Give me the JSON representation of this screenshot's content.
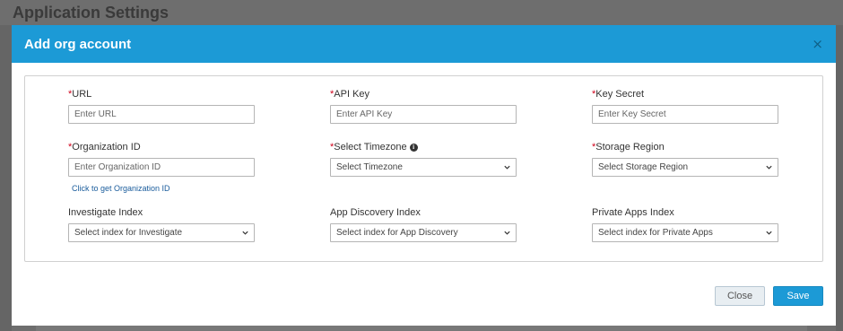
{
  "background": {
    "page_title": "Application Settings"
  },
  "modal": {
    "title": "Add org account",
    "close_glyph": "×",
    "required_marker": "*"
  },
  "fields": {
    "url": {
      "label": "URL",
      "placeholder": "Enter URL",
      "required": true
    },
    "api_key": {
      "label": "API Key",
      "placeholder": "Enter API Key",
      "required": true
    },
    "key_secret": {
      "label": "Key Secret",
      "placeholder": "Enter Key Secret",
      "required": true
    },
    "org_id": {
      "label": "Organization ID",
      "placeholder": "Enter Organization ID",
      "required": true,
      "help_link": "Click to get Organization ID"
    },
    "timezone": {
      "label": "Select Timezone",
      "selected": "Select Timezone",
      "required": true,
      "info_glyph": "i"
    },
    "storage_region": {
      "label": "Storage Region",
      "selected": "Select Storage Region",
      "required": true
    },
    "investigate_index": {
      "label": "Investigate Index",
      "selected": "Select index for Investigate"
    },
    "app_discovery_index": {
      "label": "App Discovery Index",
      "selected": "Select index for App Discovery"
    },
    "private_apps_index": {
      "label": "Private Apps Index",
      "selected": "Select index for Private Apps"
    }
  },
  "footer": {
    "close_label": "Close",
    "save_label": "Save"
  },
  "colors": {
    "header": "#1c9ad6",
    "required": "#d0021b",
    "link": "#1a5c9c",
    "overlay": "#6e6e6e"
  },
  "icons": {
    "dropdown": "chevron-down-icon",
    "info": "info-icon",
    "close": "close-icon"
  }
}
